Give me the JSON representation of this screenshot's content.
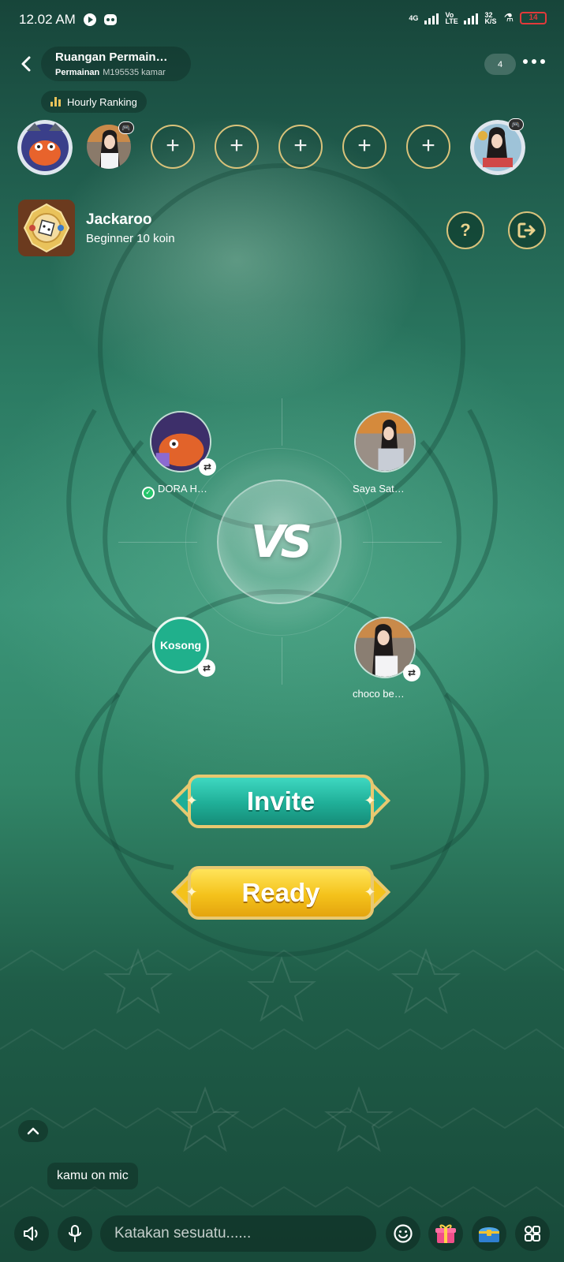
{
  "status_bar": {
    "time": "12.02 AM",
    "network": "4G",
    "volte": "Vo LTE",
    "speed": "32 K/S",
    "battery": "14"
  },
  "header": {
    "room_title": "Ruangan Permain…",
    "room_label": "Permainan",
    "room_id": "M195535 kamar",
    "online_count": "4",
    "ranking_label": "Hourly Ranking"
  },
  "seats": [
    {
      "state": "occupied",
      "icon": "host-avatar"
    },
    {
      "state": "occupied",
      "icon": "user-avatar"
    },
    {
      "state": "empty",
      "symbol": "+"
    },
    {
      "state": "empty",
      "symbol": "+"
    },
    {
      "state": "empty",
      "symbol": "+"
    },
    {
      "state": "empty",
      "symbol": "+"
    },
    {
      "state": "empty",
      "symbol": "+"
    },
    {
      "state": "occupied",
      "icon": "user-avatar"
    }
  ],
  "game": {
    "name": "Jackaroo",
    "level": "Beginner 10 koin",
    "help_symbol": "?",
    "exit_icon": "exit-icon"
  },
  "versus": {
    "label": "VS",
    "players": [
      {
        "name": "DORA H…",
        "ready": true
      },
      {
        "name": "Saya Sat…",
        "ready": false
      },
      {
        "name": "",
        "empty_label": "Kosong"
      },
      {
        "name": "choco be…",
        "ready": false
      }
    ]
  },
  "actions": {
    "invite_label": "Invite",
    "ready_label": "Ready"
  },
  "chat": {
    "messages": [
      "kamu on mic"
    ],
    "input_placeholder": "Katakan sesuatu......"
  },
  "colors": {
    "accent_gold": "#e8c870",
    "invite_teal": "#1fae97",
    "ready_yellow": "#f4c21b",
    "ready_check": "#24c56b"
  }
}
